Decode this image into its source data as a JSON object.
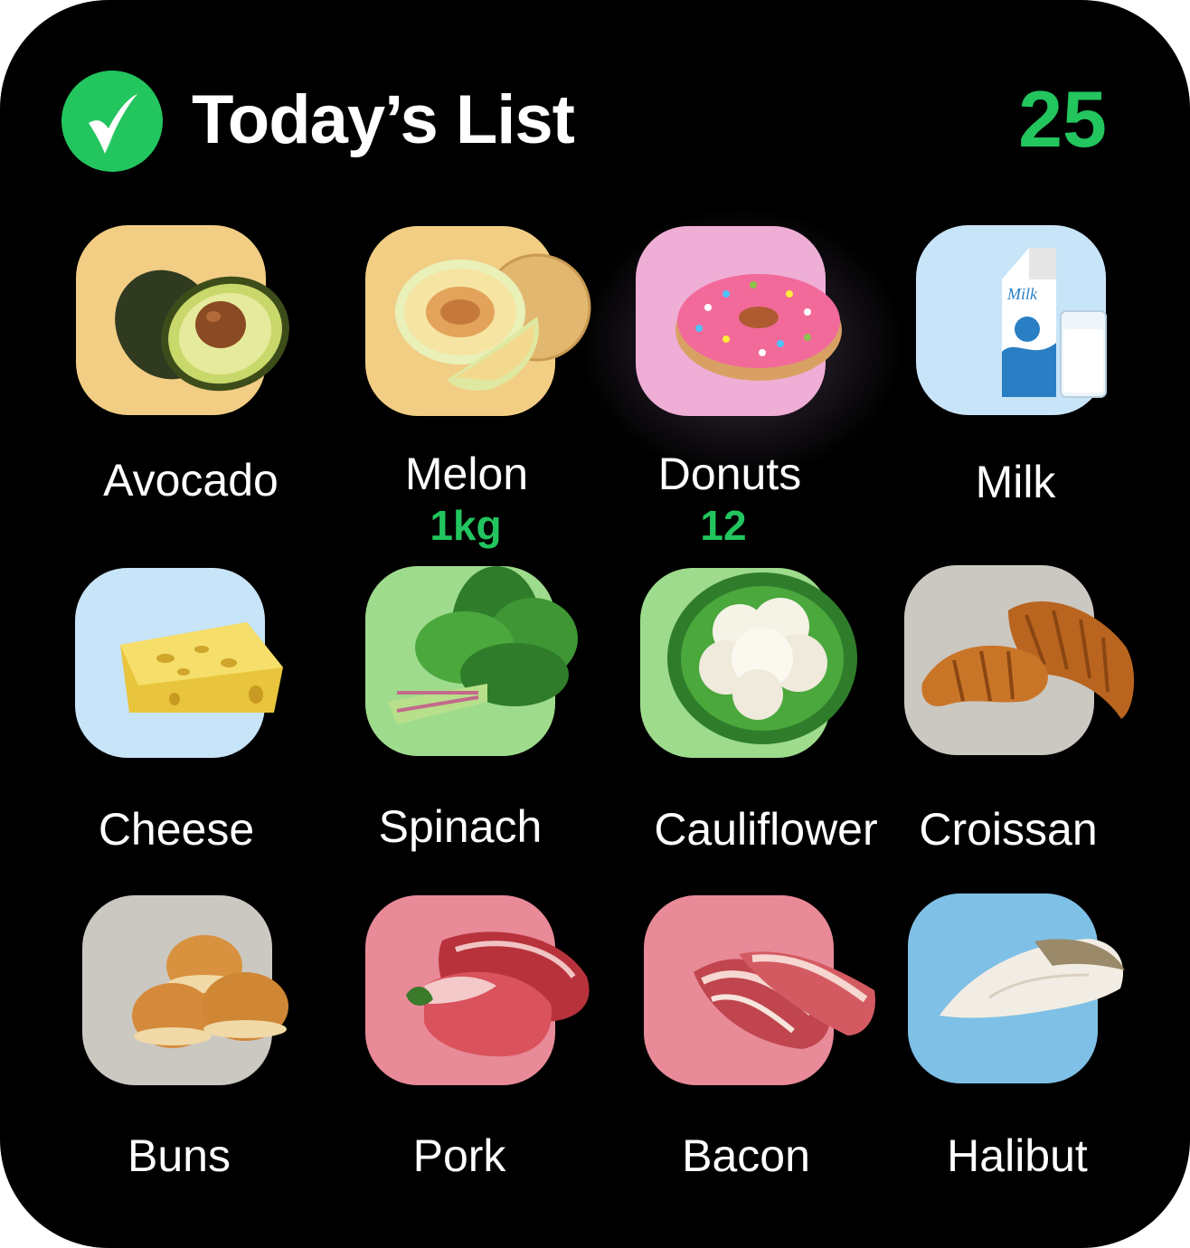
{
  "header": {
    "title": "Today’s List",
    "count": "25",
    "logo_icon": "checkmark-logo-icon"
  },
  "colors": {
    "accent": "#22c55e",
    "background": "#000000",
    "tile_yellow": "#f2cd84",
    "tile_pink": "#efaed6",
    "tile_light_blue": "#c8e4f8",
    "tile_green": "#9edb8c",
    "tile_gray": "#cbc7c1",
    "tile_rose": "#e88a98",
    "tile_blue": "#7fc0e6"
  },
  "items": [
    {
      "label": "Avocado",
      "qty": "",
      "icon": "avocado-icon"
    },
    {
      "label": "Melon",
      "qty": "1kg",
      "icon": "melon-icon"
    },
    {
      "label": "Donuts",
      "qty": "12",
      "icon": "donut-icon"
    },
    {
      "label": "Milk",
      "qty": "",
      "icon": "milk-carton-icon"
    },
    {
      "label": "Cheese",
      "qty": "",
      "icon": "cheese-icon"
    },
    {
      "label": "Spinach",
      "qty": "",
      "icon": "spinach-icon"
    },
    {
      "label": "Cauliflower",
      "qty": "",
      "icon": "cauliflower-icon"
    },
    {
      "label": "Croissan",
      "qty": "",
      "icon": "croissant-icon"
    },
    {
      "label": "Buns",
      "qty": "",
      "icon": "buns-icon"
    },
    {
      "label": "Pork",
      "qty": "",
      "icon": "pork-icon"
    },
    {
      "label": "Bacon",
      "qty": "",
      "icon": "bacon-icon"
    },
    {
      "label": "Halibut",
      "qty": "",
      "icon": "halibut-icon"
    }
  ]
}
